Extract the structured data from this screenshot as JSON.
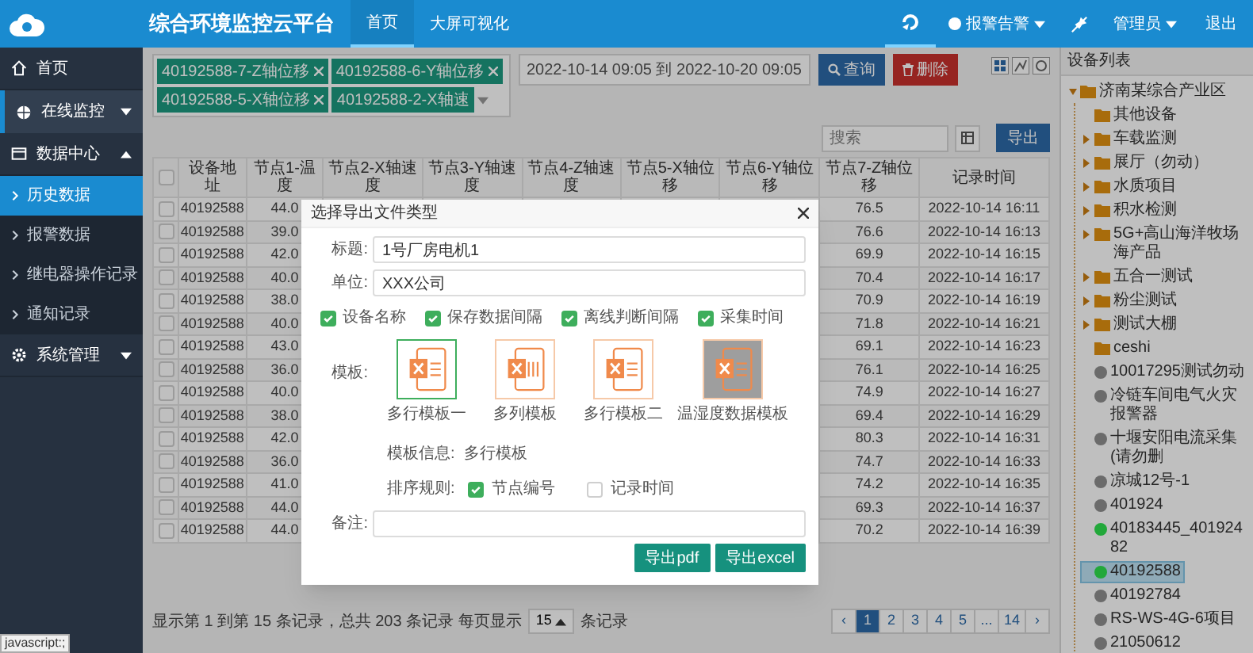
{
  "header": {
    "title": "综合环境监控云平台",
    "nav": [
      {
        "label": "首页",
        "selected": true
      },
      {
        "label": "大屏可视化",
        "selected": false
      }
    ],
    "icon_tab_selected": true,
    "alarm_menu": "报警告警",
    "user_menu": "管理员",
    "logout": "退出"
  },
  "sidebar": {
    "items": [
      {
        "label": "首页",
        "kind": "link",
        "highlighted": false
      },
      {
        "label": "在线监控",
        "kind": "menu",
        "expanded": false,
        "highlighted": true
      },
      {
        "label": "数据中心",
        "kind": "menu",
        "expanded": true,
        "highlighted": false,
        "children": [
          {
            "label": "历史数据",
            "selected": true
          },
          {
            "label": "报警数据",
            "selected": false
          },
          {
            "label": "继电器操作记录",
            "selected": false
          },
          {
            "label": "通知记录",
            "selected": false
          }
        ]
      },
      {
        "label": "系统管理",
        "kind": "menu",
        "expanded": false,
        "highlighted": false
      }
    ]
  },
  "toolbar": {
    "tags": [
      {
        "label": "40192588-7-Z轴位移",
        "removable": true
      },
      {
        "label": "40192588-6-Y轴位移",
        "removable": true
      },
      {
        "label": "40192588-5-X轴位移",
        "removable": true
      },
      {
        "label": "40192588-2-X轴速",
        "removable": false
      }
    ],
    "date_range": "2022-10-14 09:05 到 2022-10-20 09:05",
    "query_button": "查询",
    "delete_button": "删除",
    "search": {
      "placeholder": "搜索"
    },
    "export_button": "导出"
  },
  "table": {
    "select_all_checked": false,
    "columns": [
      "设备地址",
      "节点1-温度",
      "节点2-X轴速度",
      "节点3-Y轴速度",
      "节点4-Z轴速度",
      "节点5-X轴位移",
      "节点6-Y轴位移",
      "节点7-Z轴位移",
      "记录时间"
    ],
    "rows": [
      {
        "checked": false,
        "address": "40192588",
        "node1": "44.0",
        "node7": "76.5",
        "time": "2022-10-14 16:11"
      },
      {
        "checked": false,
        "address": "40192588",
        "node1": "39.0",
        "node7": "76.6",
        "time": "2022-10-14 16:13"
      },
      {
        "checked": false,
        "address": "40192588",
        "node1": "42.0",
        "node7": "69.9",
        "time": "2022-10-14 16:15"
      },
      {
        "checked": false,
        "address": "40192588",
        "node1": "40.0",
        "node7": "70.4",
        "time": "2022-10-14 16:17"
      },
      {
        "checked": false,
        "address": "40192588",
        "node1": "38.0",
        "node7": "70.9",
        "time": "2022-10-14 16:19"
      },
      {
        "checked": false,
        "address": "40192588",
        "node1": "40.0",
        "node7": "71.8",
        "time": "2022-10-14 16:21"
      },
      {
        "checked": false,
        "address": "40192588",
        "node1": "43.0",
        "node7": "69.1",
        "time": "2022-10-14 16:23"
      },
      {
        "checked": false,
        "address": "40192588",
        "node1": "36.0",
        "node7": "76.1",
        "time": "2022-10-14 16:25"
      },
      {
        "checked": false,
        "address": "40192588",
        "node1": "40.0",
        "node7": "74.9",
        "time": "2022-10-14 16:27"
      },
      {
        "checked": false,
        "address": "40192588",
        "node1": "38.0",
        "node7": "69.4",
        "time": "2022-10-14 16:29"
      },
      {
        "checked": false,
        "address": "40192588",
        "node1": "42.0",
        "node7": "80.3",
        "time": "2022-10-14 16:31"
      },
      {
        "checked": false,
        "address": "40192588",
        "node1": "36.0",
        "node7": "74.7",
        "time": "2022-10-14 16:33"
      },
      {
        "checked": false,
        "address": "40192588",
        "node1": "41.0",
        "node7": "74.2",
        "time": "2022-10-14 16:35"
      },
      {
        "checked": false,
        "address": "40192588",
        "node1": "44.0",
        "node7": "69.3",
        "time": "2022-10-14 16:37"
      },
      {
        "checked": false,
        "address": "40192588",
        "node1": "44.0",
        "node7": "70.2",
        "time": "2022-10-14 16:39"
      }
    ]
  },
  "pagination": {
    "summary": "显示第 1 到第 15 条记录，总共 203 条记录 每页显示",
    "page_size": "15",
    "suffix": "条记录",
    "pages": [
      {
        "label": "‹",
        "selected": false
      },
      {
        "label": "1",
        "selected": true
      },
      {
        "label": "2",
        "selected": false
      },
      {
        "label": "3",
        "selected": false
      },
      {
        "label": "4",
        "selected": false
      },
      {
        "label": "5",
        "selected": false
      },
      {
        "label": "...",
        "selected": false
      },
      {
        "label": "14",
        "selected": false
      },
      {
        "label": "›",
        "selected": false
      }
    ]
  },
  "device_tree": {
    "title": "设备列表",
    "items": [
      {
        "label": "济南某综合产业区",
        "kind": "folder",
        "expanded": true,
        "selected": false,
        "children": [
          {
            "label": "其他设备",
            "kind": "folder",
            "has_children": false,
            "selected": false
          },
          {
            "label": "车载监测",
            "kind": "folder",
            "has_children": true,
            "selected": false
          },
          {
            "label": "展厅（勿动）",
            "kind": "folder",
            "has_children": true,
            "selected": false
          },
          {
            "label": "水质项目",
            "kind": "folder",
            "has_children": true,
            "selected": false
          },
          {
            "label": "积水检测",
            "kind": "folder",
            "has_children": true,
            "selected": false
          },
          {
            "label": "5G+高山海洋牧场海产品",
            "kind": "folder",
            "has_children": true,
            "selected": false
          },
          {
            "label": "五合一测试",
            "kind": "folder",
            "has_children": true,
            "selected": false
          },
          {
            "label": "粉尘测试",
            "kind": "folder",
            "has_children": true,
            "selected": false
          },
          {
            "label": "测试大棚",
            "kind": "folder",
            "has_children": true,
            "selected": false
          },
          {
            "label": "ceshi",
            "kind": "folder",
            "has_children": false,
            "selected": false
          },
          {
            "label": "10017295测试勿动",
            "kind": "device",
            "color": "#6b6b6b",
            "selected": false
          },
          {
            "label": "冷链车间电气火灾报警器",
            "kind": "device",
            "color": "#6b6b6b",
            "selected": false
          },
          {
            "label": "十堰安阳电流采集(请勿删",
            "kind": "device",
            "color": "#6b6b6b",
            "selected": false
          },
          {
            "label": "凉城12号-1",
            "kind": "device",
            "color": "#6b6b6b",
            "selected": false
          },
          {
            "label": "401924",
            "kind": "device",
            "color": "#6b6b6b",
            "selected": false
          },
          {
            "label": "40183445_40192482",
            "kind": "device",
            "color": "#22a83a",
            "selected": false
          },
          {
            "label": "40192588",
            "kind": "device",
            "color": "#22a83a",
            "selected": true
          },
          {
            "label": "40192784",
            "kind": "device",
            "color": "#6b6b6b",
            "selected": false
          },
          {
            "label": "RS-WS-4G-6项目",
            "kind": "device",
            "color": "#6b6b6b",
            "selected": false
          },
          {
            "label": "21050612",
            "kind": "device",
            "color": "#6b6b6b",
            "selected": false
          }
        ]
      }
    ]
  },
  "export_dialog": {
    "title": "选择导出文件类型",
    "fields": [
      {
        "label": "标题:",
        "value": "1号厂房电机1"
      },
      {
        "label": "单位:",
        "value": "XXX公司"
      }
    ],
    "options": [
      {
        "label": "设备名称",
        "checked": true
      },
      {
        "label": "保存数据间隔",
        "checked": true
      },
      {
        "label": "离线判断间隔",
        "checked": true
      },
      {
        "label": "采集时间",
        "checked": true
      }
    ],
    "template_label": "模板:",
    "templates": [
      {
        "label": "多行模板一",
        "kind": "rows",
        "selected": true,
        "dimmed": false
      },
      {
        "label": "多列模板",
        "kind": "columns",
        "selected": false,
        "dimmed": false
      },
      {
        "label": "多行模板二",
        "kind": "rows",
        "selected": false,
        "dimmed": false
      },
      {
        "label": "温湿度数据模板",
        "kind": "rows",
        "selected": false,
        "dimmed": true
      }
    ],
    "template_info": "模板信息:  多行模板",
    "sort_label": "排序规则:",
    "sort_options": [
      {
        "label": "节点编号",
        "checked": true
      },
      {
        "label": "记录时间",
        "checked": false
      }
    ],
    "remark_label": "备注:",
    "buttons": [
      "导出pdf",
      "导出excel"
    ]
  },
  "status_text": "javascript:;"
}
